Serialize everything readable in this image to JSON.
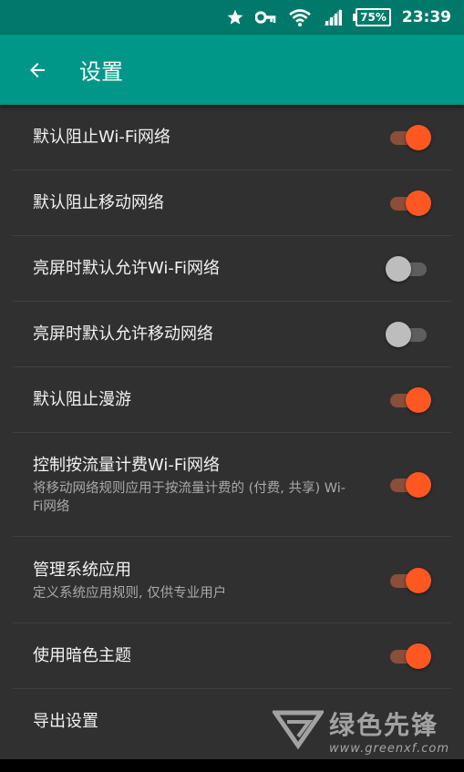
{
  "status_bar": {
    "battery": "75%",
    "time": "23:39",
    "icons": [
      "star-icon",
      "key-icon",
      "wifi-icon",
      "signal-icon",
      "battery-icon"
    ]
  },
  "app_bar": {
    "title": "设置",
    "back_icon": "arrow-back-icon",
    "color": "#009688"
  },
  "settings": {
    "items": [
      {
        "title": "默认阻止Wi-Fi网络",
        "on": true
      },
      {
        "title": "默认阻止移动网络",
        "on": true
      },
      {
        "title": "亮屏时默认允许Wi-Fi网络",
        "on": false
      },
      {
        "title": "亮屏时默认允许移动网络",
        "on": false
      },
      {
        "title": "默认阻止漫游",
        "on": true
      },
      {
        "title": "控制按流量计费Wi-Fi网络",
        "subtitle": "将移动网络规则应用于按流量计费的 (付费, 共享) Wi-Fi网络",
        "on": true
      },
      {
        "title": "管理系统应用",
        "subtitle": "定义系统应用规则, 仅供专业用户",
        "on": true
      },
      {
        "title": "使用暗色主题",
        "on": true
      },
      {
        "title": "导出设置"
      }
    ]
  },
  "watermark": {
    "name": "绿色先锋",
    "url": "www.greenxf.com"
  },
  "colors": {
    "accent": "#ff5722",
    "background": "#303030",
    "status_bar": "#00796b"
  }
}
